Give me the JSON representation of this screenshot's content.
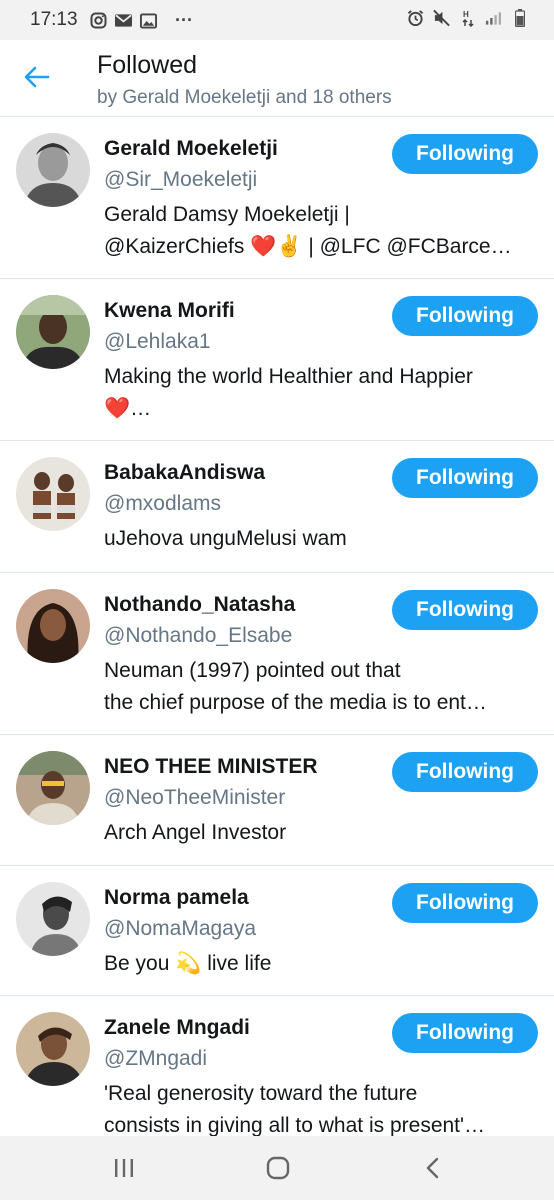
{
  "status_bar": {
    "time": "17:13",
    "more": "···"
  },
  "header": {
    "title": "Followed",
    "subtitle": "by Gerald Moekeletji and 18 others"
  },
  "accent_color": "#1da1f2",
  "users": [
    {
      "name": "Gerald Moekeletji",
      "handle": "@Sir_Moekeletji",
      "bio_lines": [
        "Gerald Damsy Moekeletji |",
        "@KaizerChiefs ❤️✌️ | @LFC @FCBarce…"
      ],
      "button": "Following"
    },
    {
      "name": "Kwena Morifi",
      "handle": "@Lehlaka1",
      "bio_lines": [
        "Making the world Healthier and Happier",
        "❤️…"
      ],
      "button": "Following"
    },
    {
      "name": "BabakaAndiswa",
      "handle": "@mxodlams",
      "bio_lines": [
        "uJehova unguMelusi wam"
      ],
      "button": "Following"
    },
    {
      "name": "Nothando_Natasha",
      "handle": "@Nothando_Elsabe",
      "bio_lines": [
        "Neuman (1997) pointed out that",
        "the chief purpose of the media is to ent…"
      ],
      "button": "Following"
    },
    {
      "name": "NEO THEE MINISTER",
      "handle": "@NeoTheeMinister",
      "bio_lines": [
        "Arch Angel Investor"
      ],
      "button": "Following"
    },
    {
      "name": "Norma pamela",
      "handle": "@NomaMagaya",
      "bio_lines": [
        "Be you 💫 live life"
      ],
      "button": "Following"
    },
    {
      "name": "Zanele Mngadi",
      "handle": "@ZMngadi",
      "bio_lines": [
        "'Real generosity toward the future",
        "consists in giving all to what is present'…"
      ],
      "button": "Following"
    }
  ]
}
